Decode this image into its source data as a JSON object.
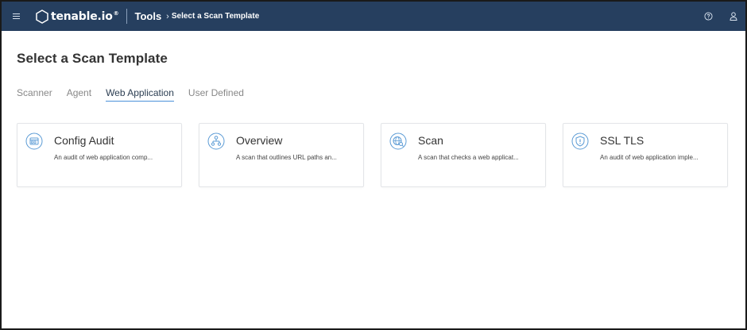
{
  "header": {
    "logo_text": "tenable.io",
    "logo_reg": "®",
    "section": "Tools",
    "breadcrumb_sep": "›",
    "breadcrumb": "Select a Scan Template",
    "icons": [
      "menu-icon",
      "tenable-logo-icon",
      "help-icon",
      "user-icon"
    ]
  },
  "page": {
    "title": "Select a Scan Template"
  },
  "tabs": [
    {
      "label": "Scanner",
      "active": false
    },
    {
      "label": "Agent",
      "active": false
    },
    {
      "label": "Web Application",
      "active": true
    },
    {
      "label": "User Defined",
      "active": false
    }
  ],
  "cards": [
    {
      "title": "Config Audit",
      "description": "An audit of web application comp...",
      "icon": "config-audit-icon"
    },
    {
      "title": "Overview",
      "description": "A scan that outlines URL paths an...",
      "icon": "overview-icon"
    },
    {
      "title": "Scan",
      "description": "A scan that checks a web applicat...",
      "icon": "scan-icon"
    },
    {
      "title": "SSL TLS",
      "description": "An audit of web application imple...",
      "icon": "ssl-tls-icon"
    }
  ],
  "colors": {
    "topbar": "#263f5f",
    "accent": "#4a90d9",
    "icon_blue": "#5b9bd5"
  }
}
